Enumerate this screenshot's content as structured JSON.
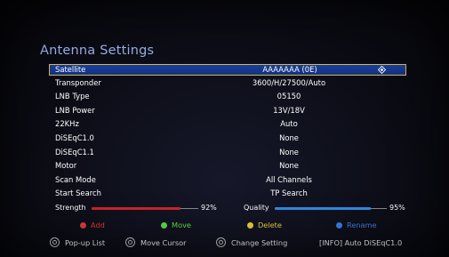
{
  "title": "Antenna Settings",
  "rows": [
    {
      "label": "Satellite",
      "value": "AAAAAAA (0E)"
    },
    {
      "label": "Transponder",
      "value": "3600/H/27500/Auto"
    },
    {
      "label": "LNB Type",
      "value": "05150"
    },
    {
      "label": "LNB Power",
      "value": "13V/18V"
    },
    {
      "label": "22KHz",
      "value": "Auto"
    },
    {
      "label": "DiSEqC1.0",
      "value": "None"
    },
    {
      "label": "DiSEqC1.1",
      "value": "None"
    },
    {
      "label": "Motor",
      "value": "None"
    },
    {
      "label": "Scan Mode",
      "value": "All Channels"
    },
    {
      "label": "Start Search",
      "value": "TP Search"
    }
  ],
  "signal": {
    "strength_label": "Strength",
    "strength_value": "92%",
    "strength_level": 0.92,
    "quality_label": "Quality",
    "quality_value": "95%",
    "quality_level": 0.95,
    "strength_color": "#c8262a",
    "quality_color": "#2f8be0"
  },
  "legend": [
    {
      "label": "Add",
      "color": "#e23a3a"
    },
    {
      "label": "Move",
      "color": "#5ee04a"
    },
    {
      "label": "Delete",
      "color": "#f0d43a"
    },
    {
      "label": "Rename",
      "color": "#3b7fe8"
    }
  ],
  "hints": [
    {
      "label": "Pop-up List",
      "icon": "ok-button-icon"
    },
    {
      "label": "Move Cursor",
      "icon": "navigation-pad-icon"
    },
    {
      "label": "Change Setting",
      "icon": "navigation-pad-icon"
    },
    {
      "label": "[INFO]  Auto DiSEqC1.0",
      "icon": ""
    }
  ],
  "colors": {
    "selection_bg": "#143a90",
    "selection_border": "#d9b94a",
    "title": "#9ab0e6"
  }
}
